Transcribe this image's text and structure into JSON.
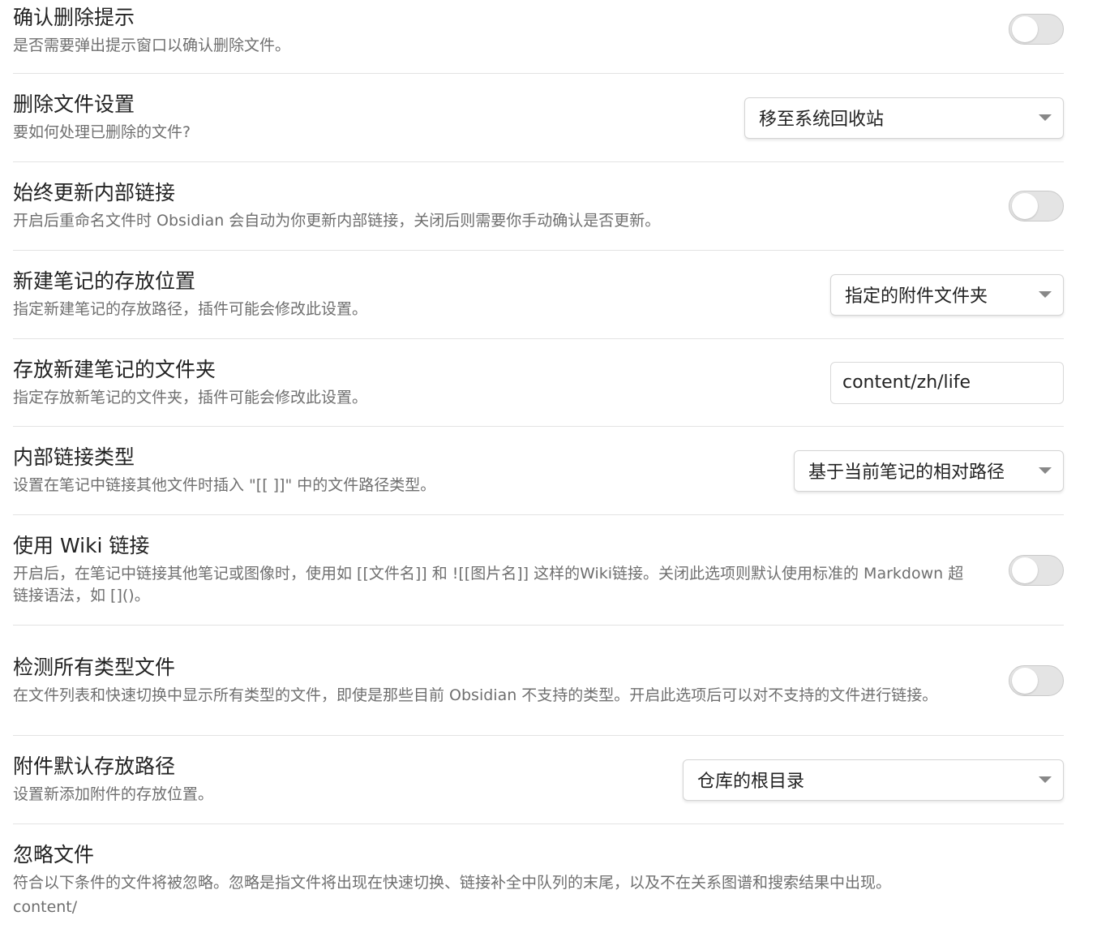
{
  "settings": [
    {
      "id": "confirm-delete",
      "name": "确认删除提示",
      "desc": "是否需要弹出提示窗口以确认删除文件。",
      "control": "toggle"
    },
    {
      "id": "delete-file-setting",
      "name": "删除文件设置",
      "desc": "要如何处理已删除的文件?",
      "control": "select",
      "value": "移至系统回收站"
    },
    {
      "id": "always-update-links",
      "name": "始终更新内部链接",
      "desc": "开启后重命名文件时 Obsidian 会自动为你更新内部链接，关闭后则需要你手动确认是否更新。",
      "control": "toggle"
    },
    {
      "id": "new-note-location",
      "name": "新建笔记的存放位置",
      "desc": "指定新建笔记的存放路径，插件可能会修改此设置。",
      "control": "select",
      "value": "指定的附件文件夹"
    },
    {
      "id": "new-note-folder",
      "name": "存放新建笔记的文件夹",
      "desc": "指定存放新笔记的文件夹，插件可能会修改此设置。",
      "control": "input",
      "value": "content/zh/life"
    },
    {
      "id": "internal-link-type",
      "name": "内部链接类型",
      "desc": "设置在笔记中链接其他文件时插入 \"[[ ]]\" 中的文件路径类型。",
      "control": "select",
      "value": "基于当前笔记的相对路径"
    },
    {
      "id": "use-wiki-links",
      "name": "使用 Wiki 链接",
      "desc": "开启后，在笔记中链接其他笔记或图像时，使用如 [[文件名]] 和 ![[图片名]] 这样的Wiki链接。关闭此选项则默认使用标准的 Markdown 超链接语法，如 []()。",
      "control": "toggle"
    },
    {
      "id": "detect-all-files",
      "name": "检测所有类型文件",
      "desc": "在文件列表和快速切换中显示所有类型的文件，即使是那些目前 Obsidian 不支持的类型。开启此选项后可以对不支持的文件进行链接。",
      "control": "toggle"
    },
    {
      "id": "attachment-path",
      "name": "附件默认存放路径",
      "desc": "设置新添加附件的存放位置。",
      "control": "select",
      "value": "仓库的根目录"
    },
    {
      "id": "ignore-files",
      "name": "忽略文件",
      "desc": "符合以下条件的文件将被忽略。忽略是指文件将出现在快速切换、链接补全中队列的末尾，以及不在关系图谱和搜索结果中出现。",
      "clipped": "content/"
    }
  ]
}
